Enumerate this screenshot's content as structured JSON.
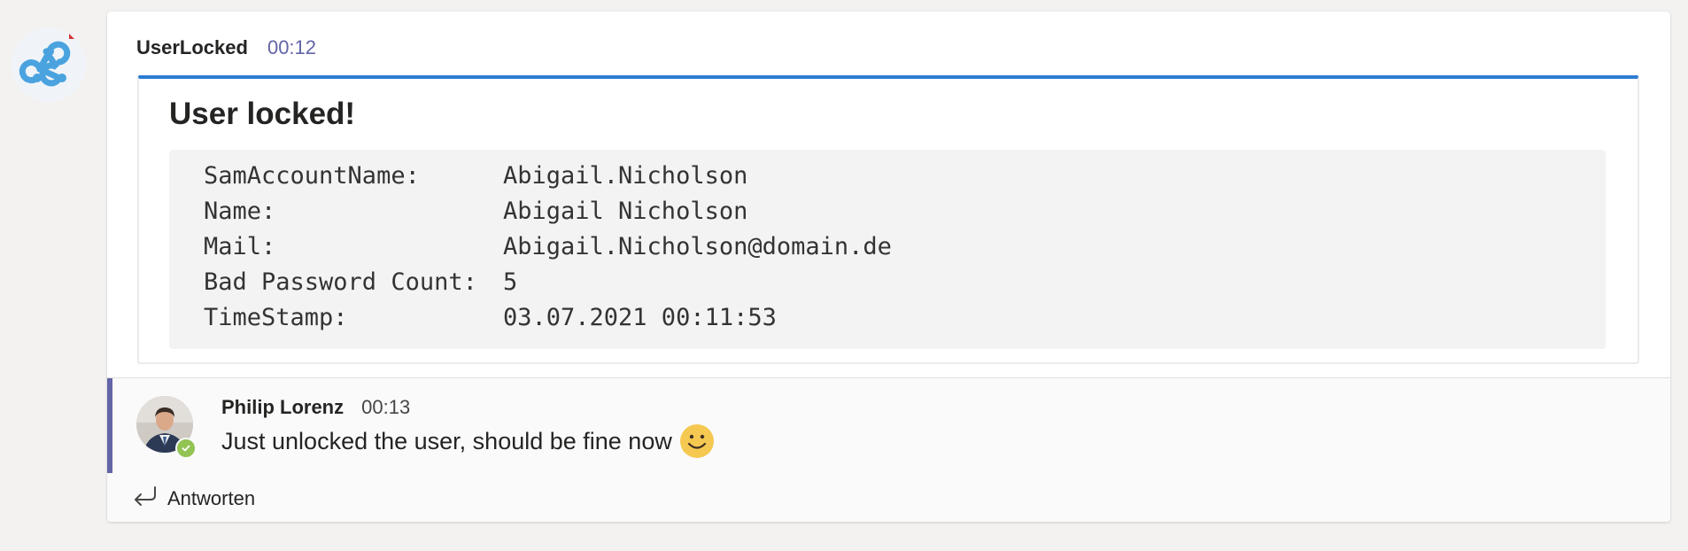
{
  "bot_message": {
    "sender": "UserLocked",
    "time": "00:12",
    "card": {
      "title": "User locked!",
      "fields": [
        {
          "key": "SamAccountName:",
          "value": "Abigail.Nicholson"
        },
        {
          "key": "Name:",
          "value": "Abigail Nicholson"
        },
        {
          "key": "Mail:",
          "value": "Abigail.Nicholson@domain.de"
        },
        {
          "key": "Bad Password Count:",
          "value": "5"
        },
        {
          "key": "TimeStamp:",
          "value": "03.07.2021 00:11:53"
        }
      ]
    }
  },
  "reply": {
    "sender": "Philip Lorenz",
    "time": "00:13",
    "text": "Just unlocked the user, should be fine now",
    "emoji": "smile-emoji",
    "presence": "available"
  },
  "answer_label": "Antworten",
  "icons": {
    "bot_avatar": "webhook-icon",
    "reply_action": "reply-arrow-icon"
  },
  "colors": {
    "accent_blue": "#2e7cd3",
    "teams_purple": "#6264a7",
    "presence_green": "#92c353"
  }
}
